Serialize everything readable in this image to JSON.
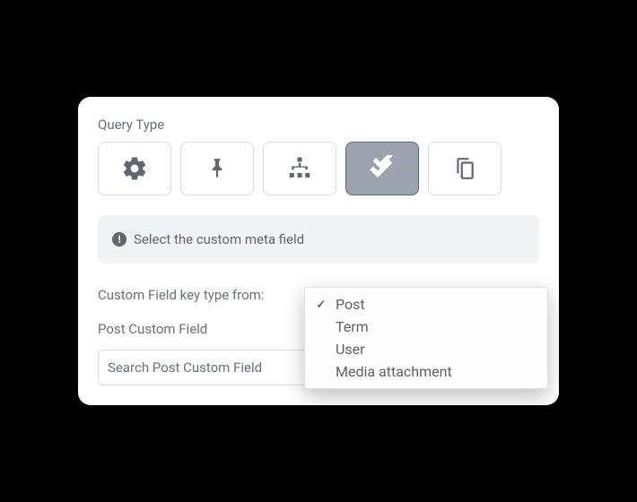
{
  "section_label": "Query Type",
  "type_buttons": [
    {
      "name": "settings",
      "active": false
    },
    {
      "name": "pin",
      "active": false
    },
    {
      "name": "hierarchy",
      "active": false
    },
    {
      "name": "check",
      "active": true
    },
    {
      "name": "copy",
      "active": false
    }
  ],
  "info_text": "Select the custom meta field",
  "key_type_label": "Custom Field key type from:",
  "post_custom_field_label": "Post Custom Field",
  "search_placeholder": "Search Post Custom Field",
  "dropdown": {
    "options": [
      {
        "label": "Post",
        "selected": true
      },
      {
        "label": "Term",
        "selected": false
      },
      {
        "label": "User",
        "selected": false
      },
      {
        "label": "Media attachment",
        "selected": false
      }
    ]
  }
}
